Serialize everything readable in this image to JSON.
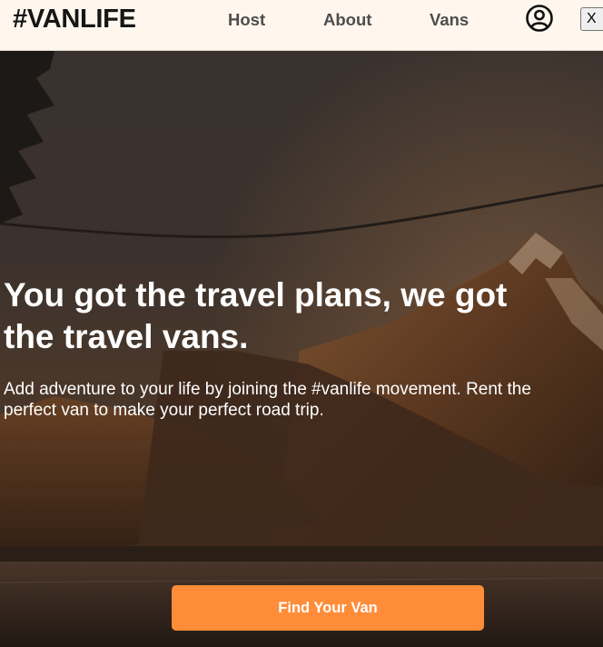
{
  "header": {
    "logo": "#VANLIFE",
    "nav": {
      "host": "Host",
      "about": "About",
      "vans": "Vans"
    },
    "avatar_icon": "user-circle-icon",
    "close_label": "X",
    "background": "#fff7ed"
  },
  "hero": {
    "title": "You got the travel plans, we got the travel vans.",
    "subtitle": "Add adventure to your life by joining the #vanlife movement. Rent the perfect van to make your perfect road trip.",
    "cta_label": "Find Your Van",
    "cta_color": "#ff8c38",
    "background_image": "mountain-lake-at-dusk"
  }
}
